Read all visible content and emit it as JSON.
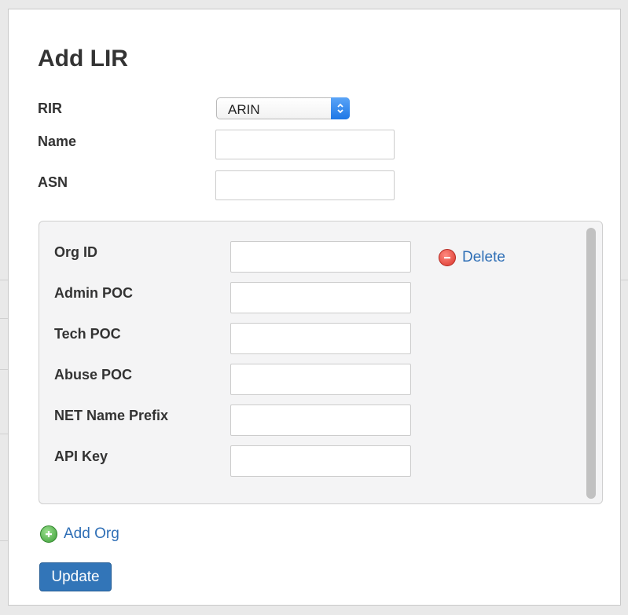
{
  "form": {
    "title": "Add LIR",
    "rir_label": "RIR",
    "rir_value": "ARIN",
    "name_label": "Name",
    "name_value": "",
    "asn_label": "ASN",
    "asn_value": ""
  },
  "org": {
    "org_id_label": "Org ID",
    "admin_poc_label": "Admin POC",
    "tech_poc_label": "Tech POC",
    "abuse_poc_label": "Abuse POC",
    "net_name_prefix_label": "NET Name Prefix",
    "api_key_label": "API Key",
    "delete_label": "Delete"
  },
  "actions": {
    "add_org_label": "Add Org",
    "update_label": "Update"
  },
  "colors": {
    "link": "#2f6fb6",
    "primary_button": "#3275b8",
    "delete_icon": "#d9342b",
    "add_icon": "#3b9d36"
  },
  "icons": {
    "select_arrows": "select-arrows-icon",
    "delete": "minus-circle-icon",
    "add": "plus-circle-icon"
  }
}
